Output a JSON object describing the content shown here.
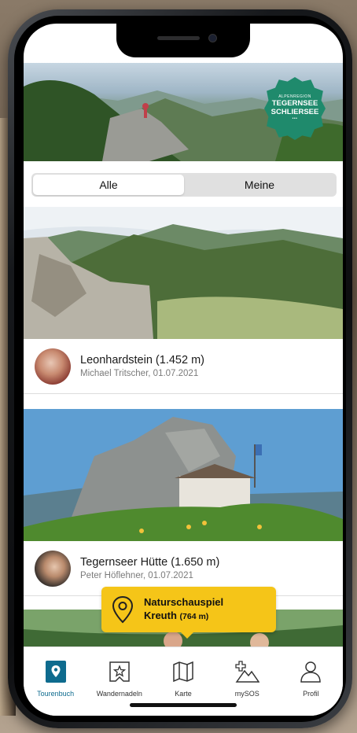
{
  "hero": {
    "badge_top": "ALPENREGION",
    "badge_line1": "TEGERNSEE",
    "badge_line2": "SCHLIERSEE",
    "badge_dots": "•••"
  },
  "segment": {
    "all_label": "Alle",
    "mine_label": "Meine",
    "selected": "Alle"
  },
  "tours": [
    {
      "title": "Leonhardstein (1.452 m)",
      "meta": "Michael Tritscher, 01.07.2021"
    },
    {
      "title": "Tegernseer Hütte (1.650 m)",
      "meta": "Peter Höflehner, 01.07.2021"
    }
  ],
  "map_tooltip": {
    "name": "Naturschauspiel",
    "name2": "Kreuth",
    "altitude": "(764 m)"
  },
  "tabbar": {
    "items": [
      {
        "label": "Tourenbuch",
        "icon": "tour-book-icon",
        "active": true
      },
      {
        "label": "Wandernadeln",
        "icon": "hiking-badge-icon",
        "active": false
      },
      {
        "label": "Karte",
        "icon": "map-icon",
        "active": false
      },
      {
        "label": "mySOS",
        "icon": "sos-mountain-icon",
        "active": false
      },
      {
        "label": "Profil",
        "icon": "profile-icon",
        "active": false
      }
    ]
  },
  "colors": {
    "accent": "#0e6b8e",
    "badge_green": "#1f8a6c",
    "tooltip_yellow": "#f5c518"
  }
}
